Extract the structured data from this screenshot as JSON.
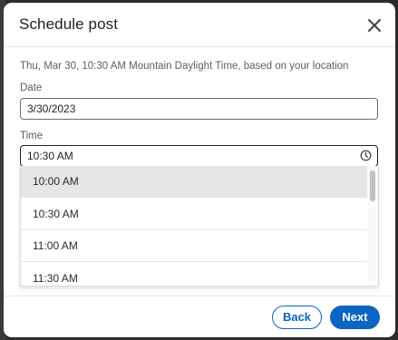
{
  "modal": {
    "title": "Schedule post",
    "subtitle": "Thu, Mar 30, 10:30 AM Mountain Daylight Time, based on your location"
  },
  "icons": {
    "close": "close-icon",
    "clock": "clock-icon"
  },
  "form": {
    "date_label": "Date",
    "date_value": "3/30/2023",
    "time_label": "Time",
    "time_value": "10:30 AM"
  },
  "time_options": [
    "10:00 AM",
    "10:30 AM",
    "11:00 AM",
    "11:30 AM"
  ],
  "footer": {
    "back_label": "Back",
    "next_label": "Next"
  },
  "colors": {
    "accent": "#0a66c2",
    "highlight_row": "#e6e6e6"
  }
}
